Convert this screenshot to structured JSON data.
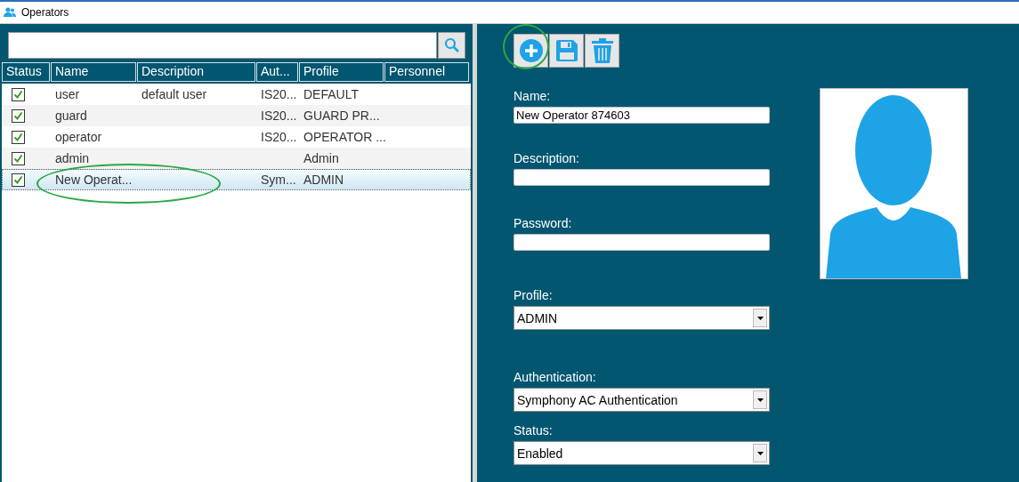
{
  "window": {
    "title": "Operators"
  },
  "table": {
    "status_header": "Status",
    "columns": [
      "Name",
      "Description",
      "Aut...",
      "Profile",
      "Personnel"
    ],
    "rows": [
      {
        "checked": true,
        "selected": false,
        "cells": [
          "user",
          "default user",
          "IS20...",
          "DEFAULT",
          ""
        ]
      },
      {
        "checked": true,
        "selected": false,
        "cells": [
          "guard",
          "",
          "IS20...",
          "GUARD PR...",
          ""
        ]
      },
      {
        "checked": true,
        "selected": false,
        "cells": [
          "operator",
          "",
          "IS20...",
          "OPERATOR ...",
          ""
        ]
      },
      {
        "checked": true,
        "selected": false,
        "cells": [
          "admin",
          "",
          "",
          "Admin",
          ""
        ]
      },
      {
        "checked": true,
        "selected": true,
        "cells": [
          "New Operat...",
          "",
          "Sym...",
          "ADMIN",
          ""
        ]
      }
    ]
  },
  "form": {
    "fields": [
      {
        "kind": "text",
        "label": "Name:",
        "value": "New Operator 874603"
      },
      {
        "kind": "text",
        "label": "Description:"
      },
      {
        "kind": "password",
        "label": "Password:"
      },
      {
        "kind": "select",
        "label": "Profile:",
        "value": "ADMIN"
      },
      {
        "kind": "select",
        "label": "Authentication:",
        "value": "Symphony AC Authentication"
      },
      {
        "kind": "select",
        "label": "Status:",
        "value": "Enabled"
      }
    ]
  }
}
